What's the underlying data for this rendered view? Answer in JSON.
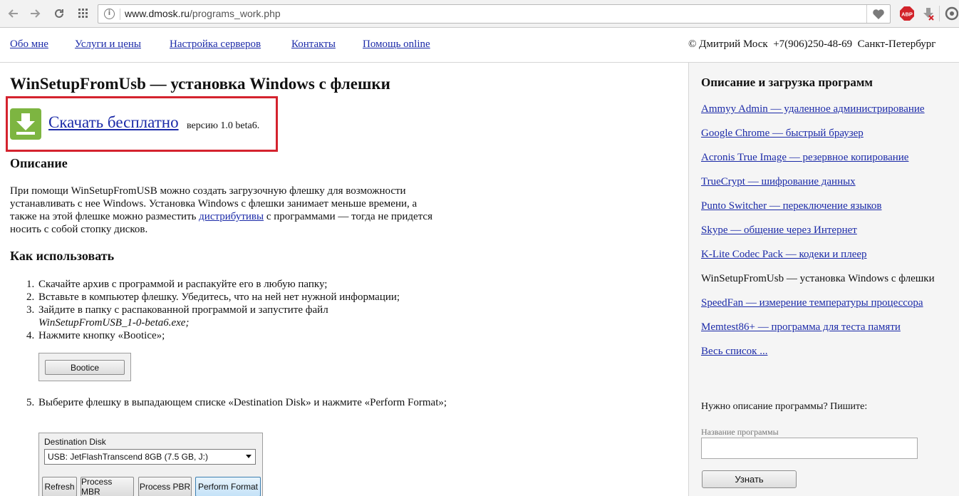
{
  "browser": {
    "url_host": "www.dmosk.ru",
    "url_path": "/programs_work.php",
    "abp_label": "ABP"
  },
  "nav": {
    "items": [
      {
        "label": "Обо мне"
      },
      {
        "label": "Услуги и цены"
      },
      {
        "label": "Настройка серверов"
      },
      {
        "label": "Контакты"
      },
      {
        "label": "Помощь online"
      }
    ],
    "copyright": "© Дмитрий Моск  +7(906)250-48-69  Санкт-Петербург"
  },
  "main": {
    "title": "WinSetupFromUsb — установка Windows с флешки",
    "download_label": "Скачать бесплатно",
    "version_text": "версию 1.0 beta6.",
    "description_heading": "Описание",
    "description_part1": "При помощи WinSetupFromUSB можно создать загрузочную флешку для возможности устанавливать с нее Windows. Установка Windows с флешки занимает меньше времени, а также на этой флешке можно разместить ",
    "description_link": "дистрибутивы",
    "description_part2": " с программами — тогда не придется носить с собой стопку дисков.",
    "howto_heading": "Как использовать",
    "steps": [
      {
        "num": "1.",
        "text": "Скачайте архив с программой и распакуйте его в любую папку;"
      },
      {
        "num": "2.",
        "text": "Вставьте в компьютер флешку. Убедитесь, что на ней нет нужной информации;"
      },
      {
        "num": "3.",
        "text": "Зайдите в папку с распакованной программой и запустите файл",
        "file": "WinSetupFromUSB_1-0-beta6.exe;"
      },
      {
        "num": "4.",
        "text": "Нажмите кнопку «Bootice»;"
      }
    ],
    "bootice_button": "Bootice",
    "step5_num": "5.",
    "step5_text": "Выберите флешку в выпадающем списке «Destination Disk» и нажмите «Perform Format»;",
    "destination_disk": {
      "label": "Destination Disk",
      "selected": "USB: JetFlashTranscend 8GB (7.5 GB, J:)",
      "buttons": [
        "Refresh",
        "Process MBR",
        "Process PBR",
        "Perform Format"
      ]
    }
  },
  "sidebar": {
    "title": "Описание и загрузка программ",
    "links": [
      {
        "label": "Ammyy Admin — удаленное администрирование",
        "active": false
      },
      {
        "label": "Google Chrome — быстрый браузер",
        "active": false
      },
      {
        "label": "Acronis True Image — резервное копирование",
        "active": false
      },
      {
        "label": "TrueCrypt — шифрование данных",
        "active": false
      },
      {
        "label": "Punto Switcher — переключение языков",
        "active": false
      },
      {
        "label": "Skype — общение через Интернет",
        "active": false
      },
      {
        "label": "K-Lite Codec Pack — кодеки и плеер",
        "active": false
      },
      {
        "label": "WinSetupFromUsb — установка Windows с флешки",
        "active": true
      },
      {
        "label": "SpeedFan — измерение температуры процессора",
        "active": false
      },
      {
        "label": "Memtest86+ — программа для теста памяти",
        "active": false
      },
      {
        "label": "Весь список ...",
        "active": false
      }
    ],
    "ask_text": "Нужно описание программы? Пишите:",
    "field_label": "Название программы",
    "field_value": "",
    "submit_label": "Узнать"
  },
  "colors": {
    "link": "#1b2aa8",
    "highlight_border": "#d4232e",
    "download_icon": "#7db541",
    "sidebar_bg": "#f5f5f5"
  }
}
